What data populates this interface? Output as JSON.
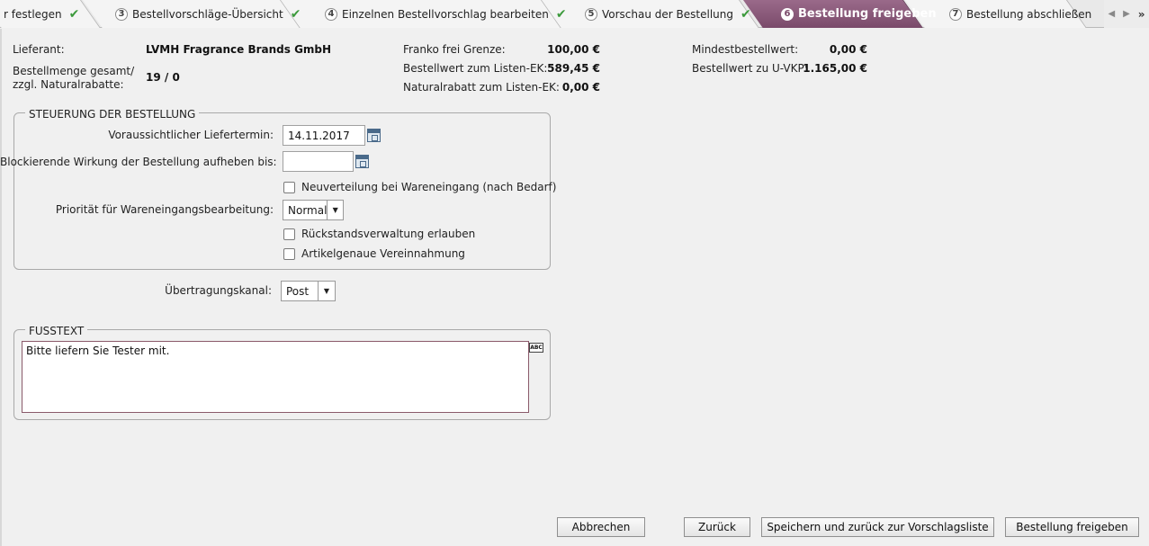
{
  "wizard": {
    "steps": [
      {
        "num": "",
        "label": "r festlegen",
        "done": true
      },
      {
        "num": "3",
        "label": "Bestellvorschläge-Übersicht",
        "done": true
      },
      {
        "num": "4",
        "label": "Einzelnen Bestellvorschlag bearbeiten",
        "done": true
      },
      {
        "num": "5",
        "label": "Vorschau der Bestellung",
        "done": true
      },
      {
        "num": "6",
        "label": "Bestellung freigeben",
        "done": false
      },
      {
        "num": "7",
        "label": "Bestellung abschließen",
        "done": false
      }
    ],
    "check_glyph": "✔",
    "nav_prev": "◀",
    "nav_next": "▶",
    "nav_more": "»",
    "accent_color": "#7a4a6a"
  },
  "summary": {
    "lieferant_label": "Lieferant:",
    "lieferant_value": "LVMH Fragrance Brands GmbH",
    "bestellmenge_label_1": "Bestellmenge gesamt/",
    "bestellmenge_label_2": "zzgl. Naturalrabatte:",
    "bestellmenge_value": "19 / 0",
    "franko_label": "Franko frei Grenze:",
    "franko_value": "100,00 €",
    "listen_ek_label": "Bestellwert zum Listen-EK:",
    "listen_ek_value": "589,45 €",
    "naturalrabatt_label": "Naturalrabatt zum Listen-EK:",
    "naturalrabatt_value": "0,00 €",
    "mindest_label": "Mindestbestellwert:",
    "mindest_value": "0,00 €",
    "uvkp_label": "Bestellwert zu U-VKP:",
    "uvkp_value": "1.165,00 €"
  },
  "steuerung": {
    "title": "STEUERUNG DER BESTELLUNG",
    "liefertermin_label": "Voraussichtlicher Liefertermin:",
    "liefertermin_value": "14.11.2017",
    "blockierend_label": "Blockierende Wirkung der Bestellung aufheben bis:",
    "blockierend_value": "",
    "neuverteilung_label": "Neuverteilung bei Wareneingang (nach Bedarf)",
    "prioritaet_label": "Priorität für Wareneingangsbearbeitung:",
    "prioritaet_value": "Normal",
    "rueckstand_label": "Rückstandsverwaltung erlauben",
    "artikelgenau_label": "Artikelgenaue Vereinnahmung"
  },
  "uebertragung": {
    "label": "Übertragungskanal:",
    "value": "Post"
  },
  "fusstext": {
    "title": "FUSSTEXT",
    "text": "Bitte liefern Sie Tester mit.",
    "spell_icon_text": "ABC"
  },
  "buttons": {
    "abbrechen": "Abbrechen",
    "zurueck": "Zurück",
    "speichern": "Speichern und zurück zur Vorschlagsliste",
    "freigeben": "Bestellung freigeben"
  },
  "select_arrow": "▼"
}
